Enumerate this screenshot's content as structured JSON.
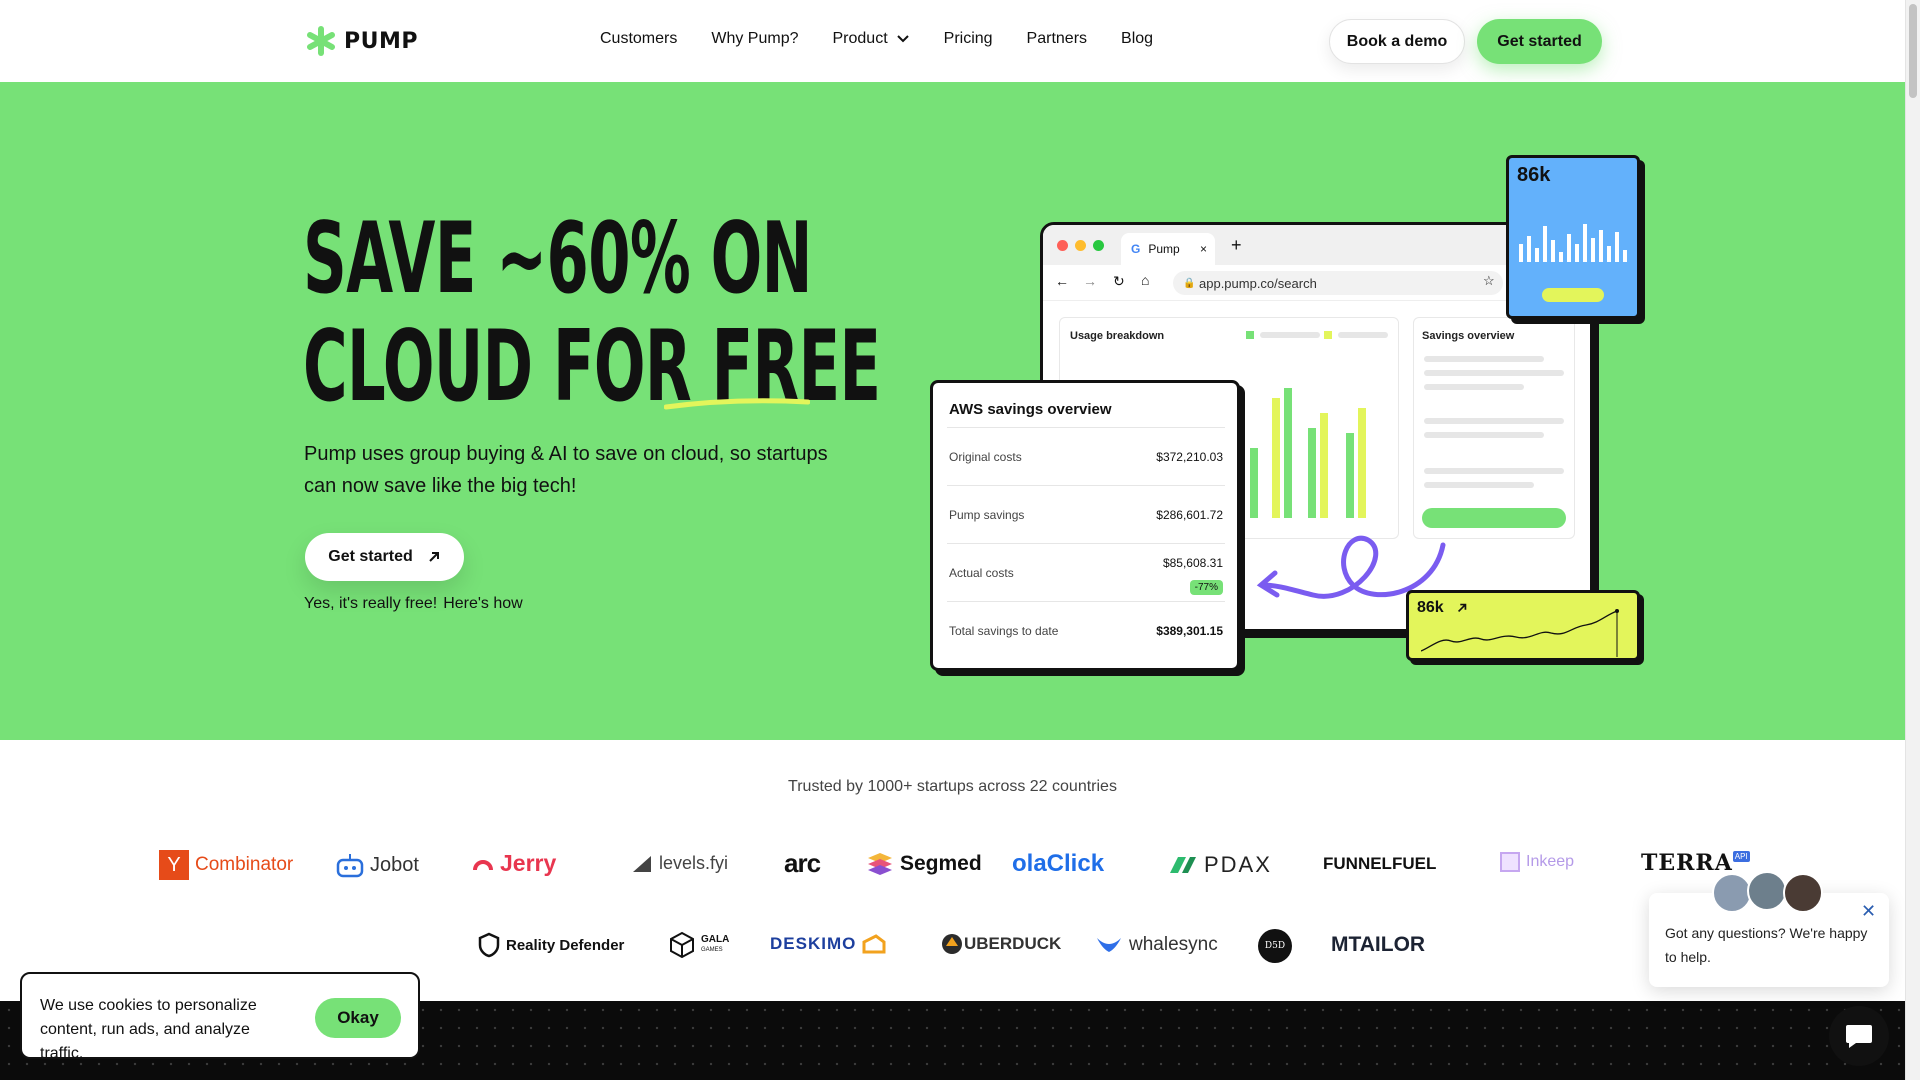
{
  "header": {
    "brand": "PUMP",
    "nav": [
      "Customers",
      "Why Pump?",
      "Product",
      "Pricing",
      "Partners",
      "Blog"
    ],
    "book_demo": "Book a demo",
    "get_started": "Get started"
  },
  "hero": {
    "headline_line1": "SAVE ~60% ON",
    "headline_line2_a": "CLOUD FOR ",
    "headline_line2_b": "FREE",
    "subcopy": "Pump uses group buying & AI to save on cloud, so startups can now save like the big tech!",
    "cta": "Get started",
    "note_a": "Yes, it's really free!",
    "note_b": "Here's how"
  },
  "illustration": {
    "browser_tab": "Pump",
    "url": "app.pump.co/search",
    "usage_panel_title": "Usage breakdown",
    "savings_panel_title": "Savings overview",
    "blue_card_value": "86k",
    "yellow_card_value": "86k",
    "aws": {
      "title": "AWS savings overview",
      "rows": [
        {
          "label": "Original costs",
          "value": "$372,210.03"
        },
        {
          "label": "Pump savings",
          "value": "$286,601.72"
        },
        {
          "label": "Actual costs",
          "value": "$85,608.31",
          "badge": "-77%"
        },
        {
          "label": "Total savings to date",
          "value": "$389,301.15"
        }
      ]
    },
    "colors": {
      "green": "#77e177",
      "lime": "#e3f55b",
      "blue": "#63b1fb"
    }
  },
  "trusted": {
    "heading": "Trusted by 1000+ startups across 22 countries",
    "logos_row1": [
      "Combinator",
      "Jobot",
      "Jerry",
      "levels.fyi",
      "arc",
      "Segmed",
      "olaClick",
      "PDAX",
      "FUNNELFUEL",
      "Inkeep",
      "TERRA"
    ],
    "logos_row2": [
      "Reality Defender",
      "GALA",
      "DESKIMO",
      "UBERDUCK",
      "whalesync",
      "D5D",
      "TAILOR"
    ],
    "yc_letter": "Y",
    "gala_sub": "GAMES",
    "terra_badge": "API"
  },
  "cookie": {
    "text": "We use cookies to personalize content, run ads, and analyze traffic.",
    "okay": "Okay"
  },
  "chat": {
    "message": "Got any questions? We're happy to help.",
    "close_icon": "close-icon"
  }
}
